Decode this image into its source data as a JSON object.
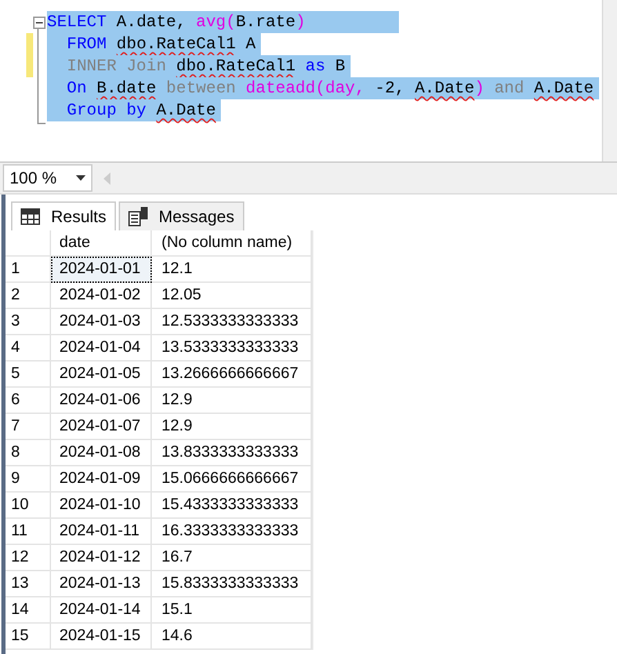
{
  "editor": {
    "lines": [
      {
        "selected": true,
        "changed": false,
        "tokens": [
          {
            "text": "SELECT ",
            "kind": "keyword"
          },
          {
            "text": "A.date, ",
            "kind": "plain"
          },
          {
            "text": "avg(",
            "kind": "function"
          },
          {
            "text": "B.rate",
            "kind": "plain"
          },
          {
            "text": ")",
            "kind": "function"
          }
        ]
      },
      {
        "selected": true,
        "changed": true,
        "tokens": [
          {
            "text": "  FROM ",
            "kind": "keyword"
          },
          {
            "text": "dbo.RateCal1",
            "kind": "unresolved"
          },
          {
            "text": " A",
            "kind": "plain"
          }
        ]
      },
      {
        "selected": true,
        "changed": true,
        "tokens": [
          {
            "text": "  INNER Join ",
            "kind": "gray"
          },
          {
            "text": "dbo.RateCal1",
            "kind": "unresolved"
          },
          {
            "text": " as",
            "kind": "keyword"
          },
          {
            "text": " B",
            "kind": "plain"
          }
        ]
      },
      {
        "selected": true,
        "changed": false,
        "tokens": [
          {
            "text": "  On ",
            "kind": "keyword"
          },
          {
            "text": "B.date",
            "kind": "unresolved"
          },
          {
            "text": " between ",
            "kind": "gray"
          },
          {
            "text": "dateadd(day,",
            "kind": "function"
          },
          {
            "text": " -2, ",
            "kind": "plain"
          },
          {
            "text": "A.Date",
            "kind": "unresolved"
          },
          {
            "text": ")",
            "kind": "function"
          },
          {
            "text": " and ",
            "kind": "gray"
          },
          {
            "text": "A.Date",
            "kind": "unresolved"
          }
        ]
      },
      {
        "selected": true,
        "changed": false,
        "tokens": [
          {
            "text": "  Group by ",
            "kind": "keyword"
          },
          {
            "text": "A.Date",
            "kind": "unresolved"
          }
        ]
      }
    ]
  },
  "zoom": {
    "value": "100 %"
  },
  "tabs": [
    {
      "label": "Results",
      "selected": true
    },
    {
      "label": "Messages",
      "selected": false
    }
  ],
  "table": {
    "columns": [
      "date",
      "(No column name)"
    ],
    "rows": [
      {
        "number": "1",
        "date": "2024-01-01",
        "value": "12.1",
        "focused": true
      },
      {
        "number": "2",
        "date": "2024-01-02",
        "value": "12.05",
        "focused": false
      },
      {
        "number": "3",
        "date": "2024-01-03",
        "value": "12.5333333333333",
        "focused": false
      },
      {
        "number": "4",
        "date": "2024-01-04",
        "value": "13.5333333333333",
        "focused": false
      },
      {
        "number": "5",
        "date": "2024-01-05",
        "value": "13.2666666666667",
        "focused": false
      },
      {
        "number": "6",
        "date": "2024-01-06",
        "value": "12.9",
        "focused": false
      },
      {
        "number": "7",
        "date": "2024-01-07",
        "value": "12.9",
        "focused": false
      },
      {
        "number": "8",
        "date": "2024-01-08",
        "value": "13.8333333333333",
        "focused": false
      },
      {
        "number": "9",
        "date": "2024-01-09",
        "value": "15.0666666666667",
        "focused": false
      },
      {
        "number": "10",
        "date": "2024-01-10",
        "value": "15.4333333333333",
        "focused": false
      },
      {
        "number": "11",
        "date": "2024-01-11",
        "value": "16.3333333333333",
        "focused": false
      },
      {
        "number": "12",
        "date": "2024-01-12",
        "value": "16.7",
        "focused": false
      },
      {
        "number": "13",
        "date": "2024-01-13",
        "value": "15.8333333333333",
        "focused": false
      },
      {
        "number": "14",
        "date": "2024-01-14",
        "value": "15.1",
        "focused": false
      },
      {
        "number": "15",
        "date": "2024-01-15",
        "value": "14.6",
        "focused": false
      }
    ]
  }
}
